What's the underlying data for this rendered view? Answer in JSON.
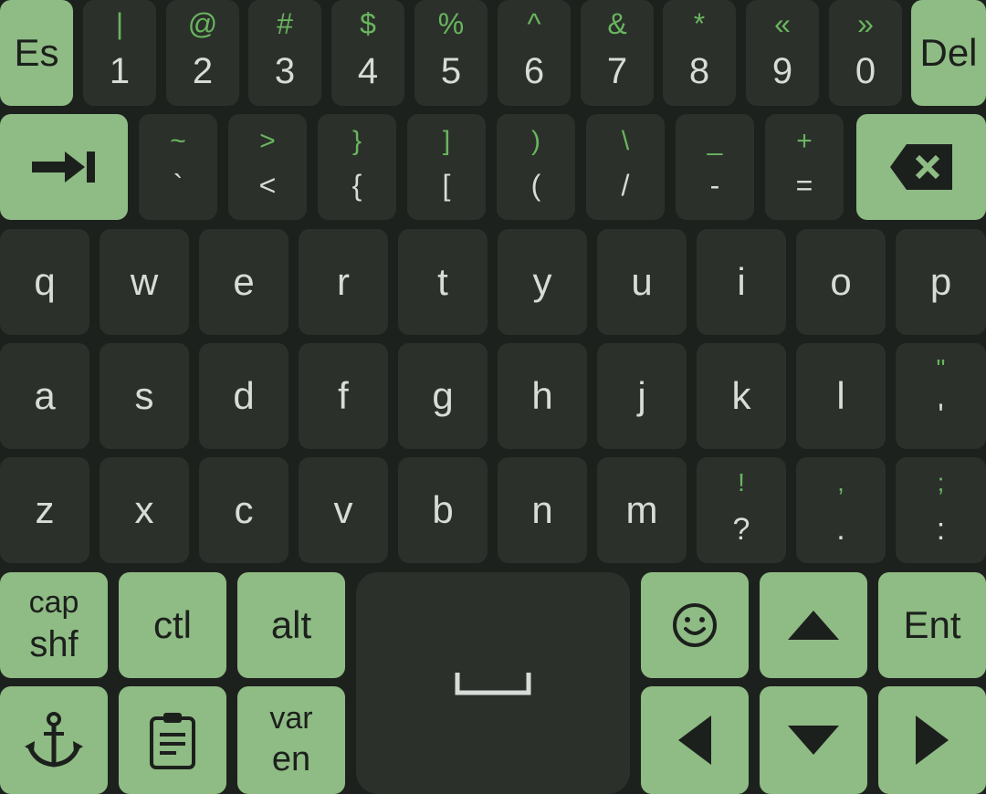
{
  "row1": {
    "esc": "Es",
    "del": "Del",
    "keys": [
      {
        "top": "|",
        "main": "1"
      },
      {
        "top": "@",
        "main": "2"
      },
      {
        "top": "#",
        "main": "3"
      },
      {
        "top": "$",
        "main": "4"
      },
      {
        "top": "%",
        "main": "5"
      },
      {
        "top": "^",
        "main": "6"
      },
      {
        "top": "&",
        "main": "7"
      },
      {
        "top": "*",
        "main": "8"
      },
      {
        "top": "«",
        "main": "9"
      },
      {
        "top": "»",
        "main": "0"
      }
    ]
  },
  "row2": {
    "tab_icon": "tab-arrow-icon",
    "backspace_icon": "backspace-icon",
    "keys": [
      {
        "top": "~",
        "main": "`"
      },
      {
        "top": ">",
        "main": "<"
      },
      {
        "top": "}",
        "main": "{"
      },
      {
        "top": "]",
        "main": "["
      },
      {
        "top": ")",
        "main": "("
      },
      {
        "top": "\\",
        "main": "/"
      },
      {
        "top": "_",
        "main": "-"
      },
      {
        "top": "+",
        "main": "="
      }
    ]
  },
  "row3": {
    "keys": [
      "q",
      "w",
      "e",
      "r",
      "t",
      "y",
      "u",
      "i",
      "o",
      "p"
    ]
  },
  "row4": {
    "keys": [
      "a",
      "s",
      "d",
      "f",
      "g",
      "h",
      "j",
      "k",
      "l"
    ],
    "extra": {
      "top": "\"",
      "main": "'"
    }
  },
  "row5": {
    "keys": [
      "z",
      "x",
      "c",
      "v",
      "b",
      "n",
      "m"
    ],
    "extra": [
      {
        "top": "!",
        "main": "?"
      },
      {
        "top": ",",
        "main": "."
      },
      {
        "top": ";",
        "main": ":"
      }
    ]
  },
  "row6": {
    "capshf_top": "cap",
    "capshf_bottom": "shf",
    "ctl": "ctl",
    "alt": "alt",
    "ent": "Ent",
    "emoji_icon": "smiley-icon",
    "up_icon": "arrow-up-icon"
  },
  "row7": {
    "anchor_icon": "anchor-icon",
    "clipboard_icon": "clipboard-icon",
    "var_top": "var",
    "var_bottom": "en",
    "space_icon": "space-bar-icon",
    "left_icon": "arrow-left-icon",
    "down_icon": "arrow-down-icon",
    "right_icon": "arrow-right-icon"
  },
  "colors": {
    "background": "#1d211d",
    "key": "#2b302b",
    "accent_key": "#8fbb85",
    "secondary_symbol": "#69b55e",
    "key_text": "#d8dcd8"
  }
}
